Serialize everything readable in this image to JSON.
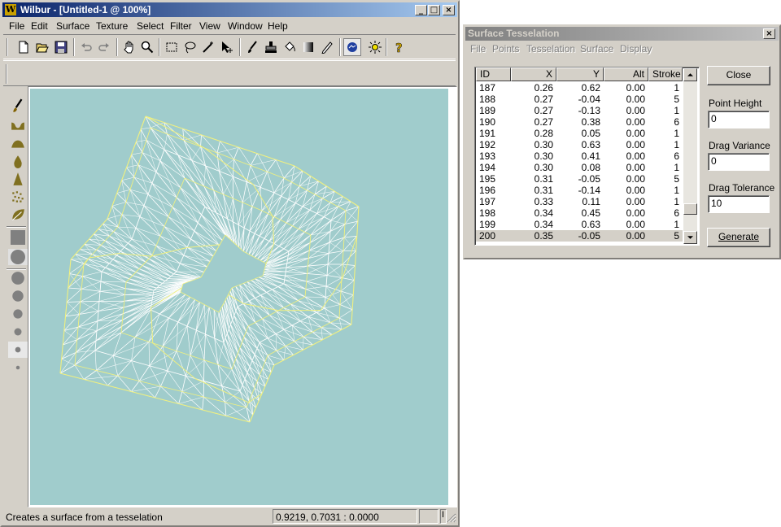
{
  "main_window": {
    "title": "Wilbur - [Untitled-1 @ 100%]",
    "logo_letter": "W",
    "menu": [
      "File",
      "Edit",
      "Surface",
      "Texture",
      "Select",
      "Filter",
      "View",
      "Window",
      "Help"
    ],
    "status_text": "Creates a surface from a tesselation",
    "status_coords": "0.9219, 0.7031 : 0.0000",
    "status_extra": "I",
    "canvas_color": "#a0cccc"
  },
  "toolbar_icons": [
    "new-icon",
    "open-icon",
    "save-icon",
    "undo-icon",
    "redo-icon",
    "hand-icon",
    "zoom-icon",
    "rect-select-icon",
    "lasso-icon",
    "magic-wand-icon",
    "move-selection-icon",
    "brush-icon",
    "stamp-icon",
    "bucket-icon",
    "gradient-icon",
    "pencil-icon",
    "render-icon",
    "light-icon",
    "help-icon"
  ],
  "left_tools": [
    "brush-tool-icon",
    "valley-tool-icon",
    "hill-tool-icon",
    "drop-tool-icon",
    "peak-tool-icon",
    "noise-tool-icon",
    "leaf-tool-icon",
    "square-brush-icon",
    "round-brush-large-icon",
    "round-brush-md-icon",
    "round-brush-sm-icon",
    "round-brush-xs-icon",
    "round-brush-xxs-icon",
    "round-brush-tiny-icon"
  ],
  "dialog": {
    "title": "Surface Tesselation",
    "menu": [
      "File",
      "Points",
      "Tesselation",
      "Surface",
      "Display"
    ],
    "columns": [
      "ID",
      "X",
      "Y",
      "Alt",
      "Stroke"
    ],
    "rows": [
      [
        "187",
        "0.26",
        "0.62",
        "0.00",
        "1"
      ],
      [
        "188",
        "0.27",
        "-0.04",
        "0.00",
        "5"
      ],
      [
        "189",
        "0.27",
        "-0.13",
        "0.00",
        "1"
      ],
      [
        "190",
        "0.27",
        "0.38",
        "0.00",
        "6"
      ],
      [
        "191",
        "0.28",
        "0.05",
        "0.00",
        "1"
      ],
      [
        "192",
        "0.30",
        "0.63",
        "0.00",
        "1"
      ],
      [
        "193",
        "0.30",
        "0.41",
        "0.00",
        "6"
      ],
      [
        "194",
        "0.30",
        "0.08",
        "0.00",
        "1"
      ],
      [
        "195",
        "0.31",
        "-0.05",
        "0.00",
        "5"
      ],
      [
        "196",
        "0.31",
        "-0.14",
        "0.00",
        "1"
      ],
      [
        "197",
        "0.33",
        "0.11",
        "0.00",
        "1"
      ],
      [
        "198",
        "0.34",
        "0.45",
        "0.00",
        "6"
      ],
      [
        "199",
        "0.34",
        "0.63",
        "0.00",
        "1"
      ],
      [
        "200",
        "0.35",
        "-0.05",
        "0.00",
        "5"
      ]
    ],
    "close_label": "Close",
    "point_height_label": "Point Height",
    "point_height_value": "0",
    "drag_variance_label": "Drag Variance",
    "drag_variance_value": "0",
    "drag_tolerance_label": "Drag Tolerance",
    "drag_tolerance_value": "10",
    "generate_label": "Generate"
  },
  "colors": {
    "title_active": "#0a246a",
    "title_gradient_end": "#a6caf0",
    "title_inactive": "#808080",
    "dialog_title_gradient_end": "#c0c0c0",
    "mesh_white": "#ffffff",
    "mesh_yellow": "#f0f080"
  }
}
